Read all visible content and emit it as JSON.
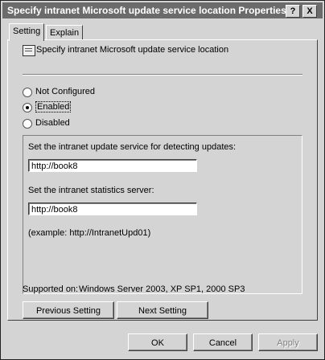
{
  "window": {
    "title": "Specify intranet Microsoft update service location Properties",
    "help_button": "?",
    "close_button": "X"
  },
  "tabs": [
    {
      "label": "Setting",
      "active": true
    },
    {
      "label": "Explain",
      "active": false
    }
  ],
  "policy": {
    "title": "Specify intranet Microsoft update service location"
  },
  "options": [
    {
      "label": "Not Configured",
      "selected": false
    },
    {
      "label": "Enabled",
      "selected": true
    },
    {
      "label": "Disabled",
      "selected": false
    }
  ],
  "settings": {
    "update_service_label": "Set the intranet update service for detecting updates:",
    "update_service_value": "http://book8",
    "statistics_label": "Set the intranet statistics server:",
    "statistics_value": "http://book8",
    "example": "(example: http://IntranetUpd01)"
  },
  "supported": {
    "label": "Supported on:",
    "value": "Windows Server 2003, XP SP1, 2000 SP3"
  },
  "nav": {
    "previous": "Previous Setting",
    "next": "Next Setting"
  },
  "buttons": {
    "ok": "OK",
    "cancel": "Cancel",
    "apply": "Apply"
  }
}
